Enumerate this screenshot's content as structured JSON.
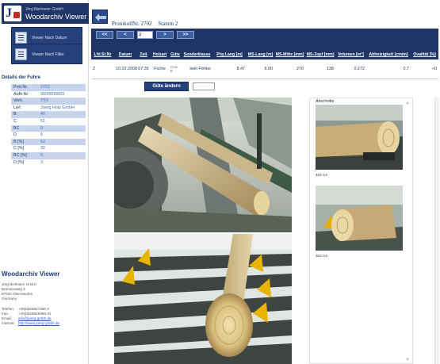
{
  "app": {
    "company": "Jörg Bielmeier GmbH",
    "title": "Woodarchiv Viewer"
  },
  "sidebar": {
    "buttons": [
      {
        "label": "Viewer Nach Datum"
      },
      {
        "label": "Viewer Nach Filter"
      }
    ],
    "details_title": "Details der Fuhre",
    "details": [
      {
        "key": "Prot.Nr.",
        "value": "2702"
      },
      {
        "key": "Auftr.Nr.",
        "value": "0600000003"
      },
      {
        "key": "Verk.",
        "value": "TSV"
      },
      {
        "key": "Lief.",
        "value": "Joerg Holz GmbH"
      },
      {
        "key": "B",
        "value": "46"
      },
      {
        "key": "C",
        "value": "51"
      },
      {
        "key": "BC",
        "value": "0"
      },
      {
        "key": "D",
        "value": "6"
      },
      {
        "key": "B [%]",
        "value": "62"
      },
      {
        "key": "C [%]",
        "value": "32"
      },
      {
        "key": "BC [%]",
        "value": "0"
      },
      {
        "key": "D [%]",
        "value": "3"
      }
    ],
    "footer": {
      "title": "Woodarchiv Viewer",
      "address": [
        "Jörg Bielmeier GmbH",
        "Brunnenweg 3",
        "87534 Oberstaufen",
        "Germany"
      ],
      "contact": [
        {
          "label": "Telefon:",
          "value": "+49(0)8386/7280 0"
        },
        {
          "label": "Fax:",
          "value": "+49(0)8386/8950-31"
        },
        {
          "label": "Email:",
          "value": "info@joerg-gmbh.de"
        },
        {
          "label": "Internet:",
          "value": "http://www.joerg-gmbh.de"
        }
      ]
    }
  },
  "header": {
    "protocol_label": "ProtokollNr. 2702",
    "stem_label": "Stamm 2"
  },
  "nav": {
    "first": "<<",
    "prev": "<",
    "page_value": "2",
    "next": ">",
    "last": ">>"
  },
  "table": {
    "columns": [
      "Lfd.St.Nr",
      "Datum",
      "Zeit",
      "Holzart",
      "Güte",
      "Sonderklasse",
      "Phy.Lang [m]",
      "MS-Lang [m]",
      "MS-Mitte [mm]",
      "MS-Zopf [mm]",
      "Volumen [m³]",
      "Abholzigkeit [cm/m]",
      "Ovalität [%]"
    ],
    "rows": [
      [
        "2",
        "10.02.2008",
        "07:35",
        "Fichte",
        "Gute B",
        "kein Fehler",
        "8.47",
        "8.00",
        "270",
        "138",
        "0.272",
        "0.7",
        "<0"
      ]
    ]
  },
  "quality": {
    "button_label": "Güte ändern",
    "input_value": ""
  },
  "photos": {
    "cuts_title": "Abschnitte",
    "cut_labels": [
      "402 cm",
      "302 cm"
    ]
  },
  "colors": {
    "navy": "#1e3566",
    "button_blue": "#25407a",
    "row_highlight": "#c7d5ec",
    "link": "#2a59b8"
  }
}
